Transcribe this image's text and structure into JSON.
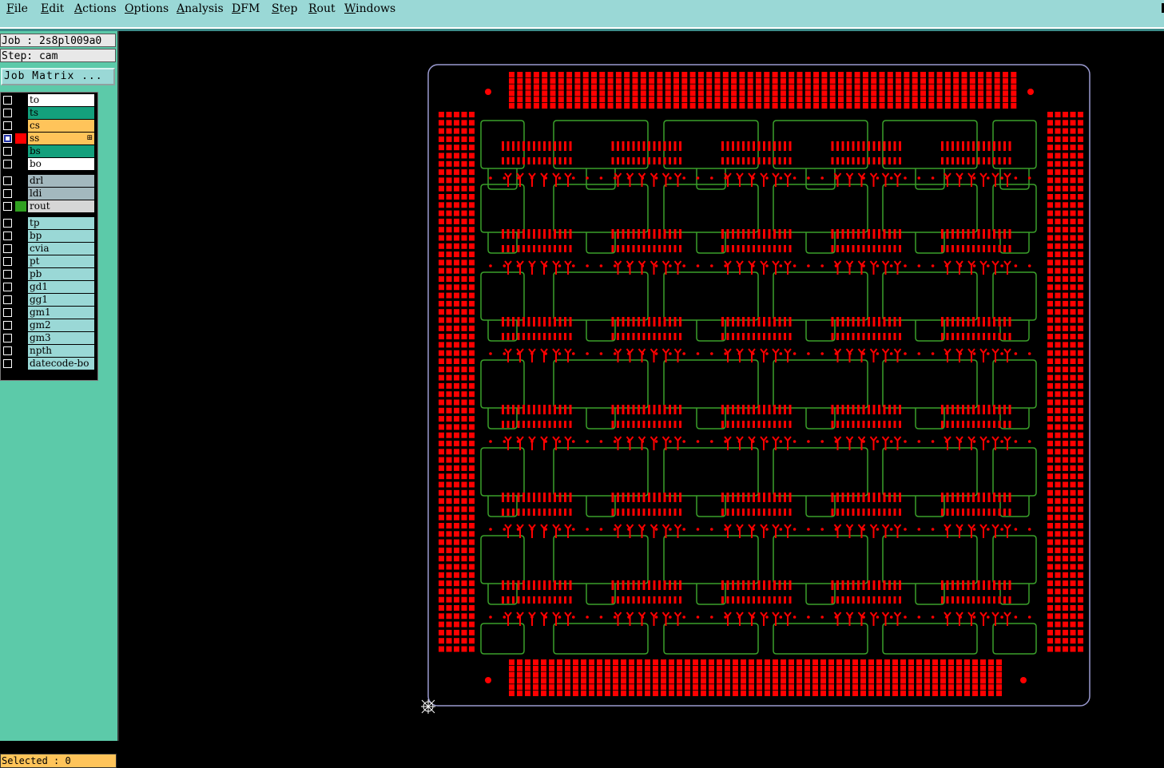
{
  "menu": [
    "File",
    "Edit",
    "Actions",
    "Options",
    "Analysis",
    "DFM",
    "Step",
    "Rout",
    "Windows"
  ],
  "job": {
    "job_label": "Job : 2s8pl009a0",
    "step_label": "Step: cam",
    "matrix_button": "Job Matrix ..."
  },
  "layers": [
    {
      "name": "to",
      "color": "#ffffff",
      "swatch": "#000000",
      "checked": false
    },
    {
      "name": "ts",
      "color": "#14a07c",
      "swatch": "#000000",
      "checked": false
    },
    {
      "name": "cs",
      "color": "#ffc45a",
      "swatch": "#000000",
      "checked": false
    },
    {
      "name": "ss",
      "color": "#ffc45a",
      "swatch": "#ff0000",
      "checked": true
    },
    {
      "name": "bs",
      "color": "#14a07c",
      "swatch": "#000000",
      "checked": false
    },
    {
      "name": "bo",
      "color": "#ffffff",
      "swatch": "#000000",
      "checked": false
    },
    {
      "name": "drl",
      "color": "#a3b8be",
      "swatch": "#000000",
      "checked": false
    },
    {
      "name": "ldi",
      "color": "#a3b8be",
      "swatch": "#000000",
      "checked": false
    },
    {
      "name": "rout",
      "color": "#d6d6d6",
      "swatch": "#30a020",
      "checked": false
    },
    {
      "name": "tp",
      "color": "#9ad8d6",
      "swatch": "#000000",
      "checked": false
    },
    {
      "name": "bp",
      "color": "#9ad8d6",
      "swatch": "#000000",
      "checked": false
    },
    {
      "name": "cvia",
      "color": "#9ad8d6",
      "swatch": "#000000",
      "checked": false
    },
    {
      "name": "pt",
      "color": "#9ad8d6",
      "swatch": "#000000",
      "checked": false
    },
    {
      "name": "pb",
      "color": "#9ad8d6",
      "swatch": "#000000",
      "checked": false
    },
    {
      "name": "gd1",
      "color": "#9ad8d6",
      "swatch": "#000000",
      "checked": false
    },
    {
      "name": "gg1",
      "color": "#9ad8d6",
      "swatch": "#000000",
      "checked": false
    },
    {
      "name": "gm1",
      "color": "#9ad8d6",
      "swatch": "#000000",
      "checked": false
    },
    {
      "name": "gm2",
      "color": "#9ad8d6",
      "swatch": "#000000",
      "checked": false
    },
    {
      "name": "gm3",
      "color": "#9ad8d6",
      "swatch": "#000000",
      "checked": false
    },
    {
      "name": "npth",
      "color": "#9ad8d6",
      "swatch": "#000000",
      "checked": false
    },
    {
      "name": "datecode-bo",
      "color": "#9ad8d6",
      "swatch": "#000000",
      "checked": false
    }
  ],
  "status": {
    "selected": "Selected : 0"
  },
  "board": {
    "pad_color": "#ff0000",
    "rout_color": "#3aa02a",
    "outline_color": "#9a9ad0",
    "panel_columns": 5,
    "panel_rows": 6
  }
}
